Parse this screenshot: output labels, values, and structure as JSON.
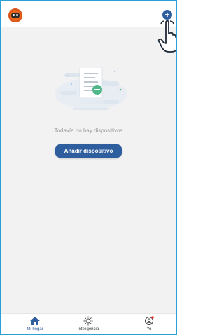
{
  "header": {
    "avatar_icon": "robot-avatar-icon",
    "add_icon": "plus-circle-icon",
    "add_label": "+"
  },
  "main": {
    "empty_message": "Todavía no hay dispositivos",
    "add_device_label": "Añadir dispositivo"
  },
  "tabs": [
    {
      "label": "Mi hogar",
      "icon": "home-icon",
      "active": true
    },
    {
      "label": "Inteligencia",
      "icon": "sun-icon",
      "active": false
    },
    {
      "label": "Yo",
      "icon": "user-icon",
      "active": false
    }
  ],
  "colors": {
    "accent": "#2f5e9e",
    "frame_border": "#2aa1d6",
    "background": "#f2f2f2",
    "avatar": "#e9651b"
  }
}
